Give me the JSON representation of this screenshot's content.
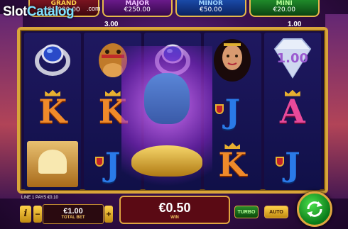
{
  "brand": {
    "name_part1": "Slot",
    "name_part2": "Catalog",
    "tld": ".com"
  },
  "jackpots": [
    {
      "name": "GRAND",
      "amount": "€1,000.00"
    },
    {
      "name": "MAJOR",
      "amount": "€250.00"
    },
    {
      "name": "MINOR",
      "amount": "€50.00"
    },
    {
      "name": "MINI",
      "amount": "€20.00"
    }
  ],
  "reel_values": {
    "left": "3.00",
    "right": "1.00"
  },
  "reels": [
    [
      "ring-icon",
      "K",
      "palace-icon"
    ],
    [
      "camel-icon",
      "K",
      "J"
    ],
    [
      "ring-icon",
      "genie-icon",
      "lamp-icon"
    ],
    [
      "princess-icon",
      "J",
      "K"
    ],
    [
      "diamond-icon",
      "A",
      "J"
    ]
  ],
  "diamond_value": "1.00",
  "line_info": "LINE 1 PAYS €0.10",
  "bet": {
    "value": "€1.00",
    "label": "TOTAL BET"
  },
  "win": {
    "value": "€0.50",
    "label": "WIN"
  },
  "buttons": {
    "info": "i",
    "minus": "−",
    "plus": "+",
    "turbo": "TURBO",
    "auto": "AUTO"
  },
  "colors": {
    "frame": "#d9a53a",
    "spin": "#1aa02a",
    "win_panel": "#5a0a14"
  }
}
